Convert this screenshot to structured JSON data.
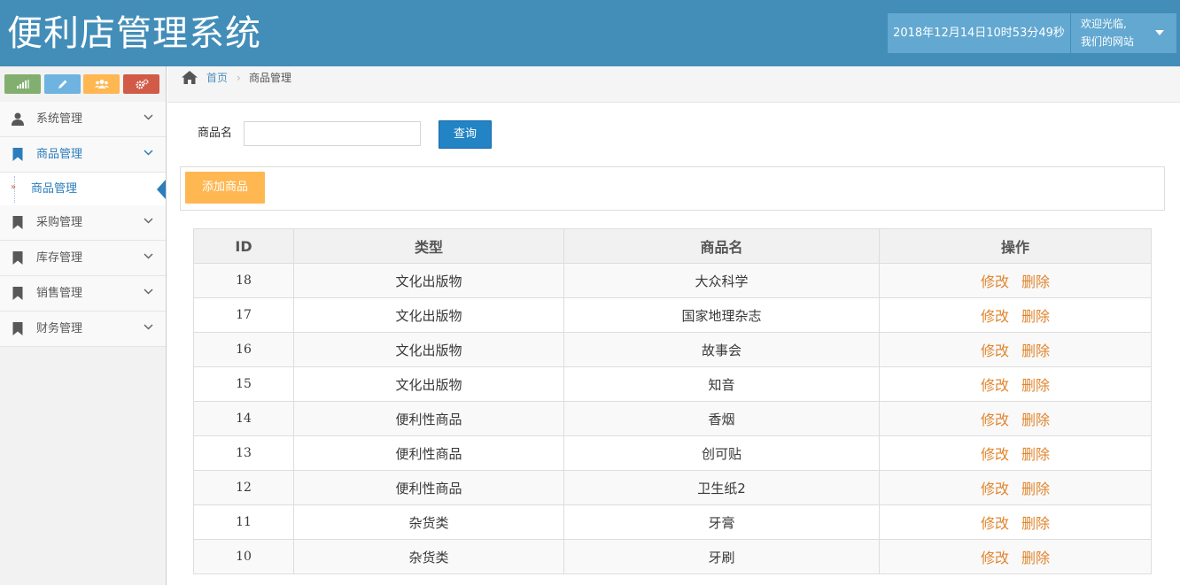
{
  "header": {
    "app_title": "便利店管理系统",
    "datetime": "2018年12月14日10时53分49秒",
    "welcome_line1": "欢迎光临,",
    "welcome_line2": "我们的网站"
  },
  "sidebar": {
    "shortcuts": [
      {
        "name": "signal-icon",
        "color": "#82af6f"
      },
      {
        "name": "pencil-icon",
        "color": "#6fb3e0"
      },
      {
        "name": "users-icon",
        "color": "#ffb752"
      },
      {
        "name": "cogs-icon",
        "color": "#d15b47"
      }
    ],
    "items": [
      {
        "label": "系统管理",
        "icon": "user-icon"
      },
      {
        "label": "商品管理",
        "icon": "bookmark-icon",
        "active": true
      },
      {
        "label": "采购管理",
        "icon": "bookmark-icon"
      },
      {
        "label": "库存管理",
        "icon": "bookmark-icon"
      },
      {
        "label": "销售管理",
        "icon": "bookmark-icon"
      },
      {
        "label": "财务管理",
        "icon": "bookmark-icon"
      }
    ],
    "sub_item": {
      "label": "商品管理",
      "arrow": "»"
    }
  },
  "breadcrumb": {
    "home": "首页",
    "separator": "›",
    "current": "商品管理"
  },
  "search": {
    "label": "商品名",
    "value": "",
    "button": "查询"
  },
  "toolbar": {
    "add_label": "添加商品"
  },
  "table": {
    "headers": [
      "ID",
      "类型",
      "商品名",
      "操作"
    ],
    "edit_label": "修改",
    "delete_label": "删除",
    "rows": [
      {
        "id": "18",
        "type": "文化出版物",
        "name": "大众科学"
      },
      {
        "id": "17",
        "type": "文化出版物",
        "name": "国家地理杂志"
      },
      {
        "id": "16",
        "type": "文化出版物",
        "name": "故事会"
      },
      {
        "id": "15",
        "type": "文化出版物",
        "name": "知音"
      },
      {
        "id": "14",
        "type": "便利性商品",
        "name": "香烟"
      },
      {
        "id": "13",
        "type": "便利性商品",
        "name": "创可贴"
      },
      {
        "id": "12",
        "type": "便利性商品",
        "name": "卫生纸2"
      },
      {
        "id": "11",
        "type": "杂货类",
        "name": "牙膏"
      },
      {
        "id": "10",
        "type": "杂货类",
        "name": "牙刷"
      }
    ]
  },
  "colors": {
    "header_bg": "#438eb9",
    "header_box": "#62a8d1",
    "accent": "#2b7dbc",
    "action_link": "#e1862f",
    "add_button": "#ffb752",
    "search_button": "#2283c5"
  }
}
